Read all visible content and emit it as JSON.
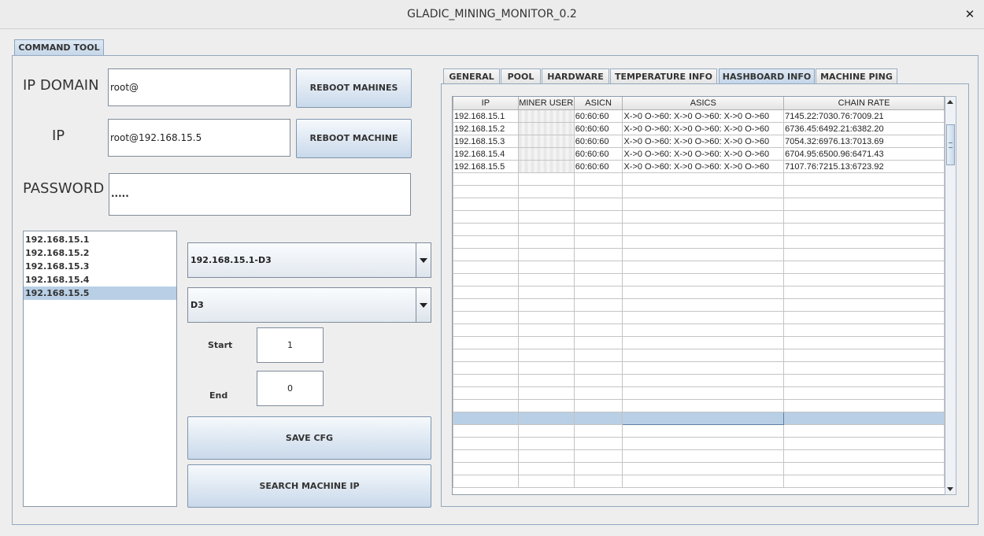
{
  "window": {
    "title": "GLADIC_MINING_MONITOR_0.2",
    "close_glyph": "✕"
  },
  "outer_tab": {
    "label": "COMMAND TOOL"
  },
  "form": {
    "ip_domain_label": "IP DOMAIN",
    "ip_domain_value": "root@",
    "ip_label": "IP",
    "ip_value": "root@192.168.15.5",
    "password_label": "PASSWORD",
    "password_value": ".....",
    "reboot_machines_label": "REBOOT MAHINES",
    "reboot_machine_label": "REBOOT MACHINE"
  },
  "ip_list": {
    "items": [
      "192.168.15.1",
      "192.168.15.2",
      "192.168.15.3",
      "192.168.15.4",
      "192.168.15.5"
    ],
    "selected_index": 4
  },
  "config": {
    "machine_select": "192.168.15.1-D3",
    "model_select": "D3",
    "start_label": "Start",
    "start_value": "1",
    "end_label": "End",
    "end_value": "0",
    "save_label": "SAVE CFG",
    "search_label": "SEARCH MACHINE IP"
  },
  "tabs": [
    {
      "label": "GENERAL",
      "active": false
    },
    {
      "label": "POOL",
      "active": false
    },
    {
      "label": "HARDWARE",
      "active": false
    },
    {
      "label": "TEMPERATURE INFO",
      "active": false
    },
    {
      "label": "HASHBOARD INFO",
      "active": true
    },
    {
      "label": "MACHINE PING",
      "active": false
    }
  ],
  "table": {
    "columns": [
      "IP",
      "MINER USER",
      "ASICN",
      "ASICS",
      "CHAIN RATE"
    ],
    "rows": [
      [
        "192.168.15.1",
        "",
        "60:60:60",
        "X->0 O->60: X->0 O->60: X->0 O->60",
        "7145.22:7030.76:7009.21"
      ],
      [
        "192.168.15.2",
        "",
        "60:60:60",
        "X->0 O->60: X->0 O->60: X->0 O->60",
        "6736.45:6492.21:6382.20"
      ],
      [
        "192.168.15.3",
        "",
        "60:60:60",
        "X->0 O->60: X->0 O->60: X->0 O->60",
        "7054.32:6976.13:7013.69"
      ],
      [
        "192.168.15.4",
        "",
        "60:60:60",
        "X->0 O->60: X->0 O->60: X->0 O->60",
        "6704.95:6500.96:6471.43"
      ],
      [
        "192.168.15.5",
        "",
        "60:60:60",
        "X->0 O->60: X->0 O->60: X->0 O->60",
        "7107.76:7215.13:6723.92"
      ]
    ],
    "empty_rows": 25,
    "selected_empty_row": 19
  },
  "colors": {
    "selection": "#b8cfe5",
    "tab_active": "#c2d4e8",
    "border": "#93a9c1"
  }
}
